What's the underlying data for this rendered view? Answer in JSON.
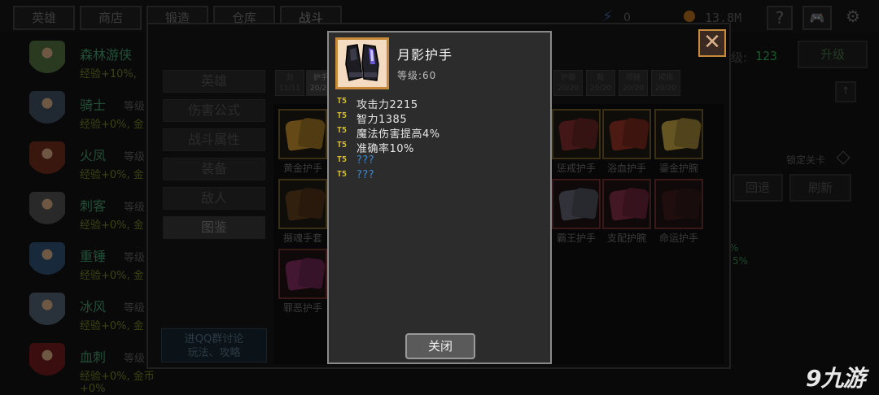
{
  "topbar": {
    "tabs": [
      "英雄",
      "商店",
      "锻造",
      "仓库",
      "战斗"
    ],
    "energy_value": "0",
    "gold_value": "13.8M",
    "help_label": "?"
  },
  "heroes": [
    {
      "name": "森林游侠",
      "level_label": "",
      "exp": "经验+10%,"
    },
    {
      "name": "骑士",
      "level_label": "等级",
      "exp": "经验+0%, 金"
    },
    {
      "name": "火凤",
      "level_label": "等级",
      "exp": "经验+0%, 金"
    },
    {
      "name": "刺客",
      "level_label": "等级",
      "exp": "经验+0%, 金"
    },
    {
      "name": "重锤",
      "level_label": "等级",
      "exp": "经验+0%, 金"
    },
    {
      "name": "冰风",
      "level_label": "等级",
      "exp": "经验+0%, 金"
    },
    {
      "name": "血刺",
      "level_label": "等级",
      "exp": "经验+0%, 金币+0%"
    }
  ],
  "panel": {
    "menu": [
      "英雄",
      "伤害公式",
      "战斗属性",
      "装备",
      "敌人",
      "图鉴"
    ],
    "qq_line1": "进QQ群讨论",
    "qq_line2": "玩法、攻略",
    "slot_tabs": [
      {
        "label": "剑",
        "count": "11/11"
      },
      {
        "label": "护手",
        "count": "20/20"
      },
      {
        "label": "护腿",
        "count": "20/20"
      },
      {
        "label": "靴",
        "count": "20/20"
      },
      {
        "label": "项链",
        "count": "20/20"
      },
      {
        "label": "戒指",
        "count": "20/20"
      }
    ],
    "items": [
      {
        "name": "黄金护手"
      },
      {
        "name": "惩戒护手"
      },
      {
        "name": "浴血护手"
      },
      {
        "name": "鎏金护腕"
      },
      {
        "name": "摄魂手套"
      },
      {
        "name": "霸王护手"
      },
      {
        "name": "支配护腕"
      },
      {
        "name": "命运护手"
      },
      {
        "name": "罪恶护手"
      }
    ]
  },
  "right": {
    "level_label": "级:",
    "level_value": "123",
    "upgrade_label": "升级",
    "lock_label": "锁定关卡",
    "back_label": "回退",
    "refresh_label": "刷新",
    "pct1": "%",
    "pct2": "5%"
  },
  "popup": {
    "item_name": "月影护手",
    "level_text": "等级:60",
    "tier": "T5",
    "attributes": [
      "攻击力2215",
      "智力1385",
      "魔法伤害提高4%",
      "准确率10%",
      "???",
      "???"
    ],
    "close_label": "关闭",
    "x_label": "✕"
  },
  "watermark": "9九游",
  "colors": {
    "tier_yellow": "#d7c227",
    "unknown_blue": "#3f86c9",
    "hero_name": "#3f8f66",
    "level_green": "#2f9f4f"
  }
}
